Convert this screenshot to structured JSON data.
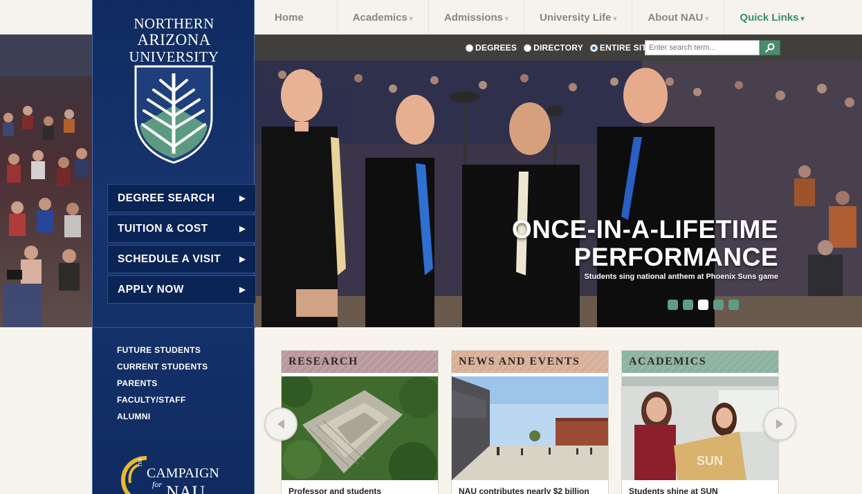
{
  "nav": {
    "items": [
      {
        "label": "Home",
        "caret": ""
      },
      {
        "label": "Academics",
        "caret": "▾"
      },
      {
        "label": "Admissions",
        "caret": "▾"
      },
      {
        "label": "University Life",
        "caret": "▾"
      },
      {
        "label": "About NAU",
        "caret": "▾"
      },
      {
        "label": "Quick Links",
        "caret": "▾"
      }
    ]
  },
  "search": {
    "options": [
      "DEGREES",
      "DIRECTORY",
      "ENTIRE SITE"
    ],
    "selected": "ENTIRE SITE",
    "placeholder": "Enter search term..."
  },
  "logo": {
    "line1": "NORTHERN",
    "line2": "ARIZONA",
    "line3": "UNIVERSITY"
  },
  "ctas": [
    {
      "label": "DEGREE SEARCH",
      "arrow": "▶"
    },
    {
      "label": "TUITION & COST",
      "arrow": "▶"
    },
    {
      "label": "SCHEDULE A VISIT",
      "arrow": "▶"
    },
    {
      "label": "APPLY NOW",
      "arrow": "▶"
    }
  ],
  "audiences": [
    "FUTURE STUDENTS",
    "CURRENT STUDENTS",
    "PARENTS",
    "FACULTY/STAFF",
    "ALUMNI"
  ],
  "campaign": {
    "the": "THE",
    "word": "CAMPAIGN",
    "for": "for",
    "nau": "NAU"
  },
  "hero": {
    "headline_line1": "ONCE-IN-A-LIFETIME",
    "headline_line2": "PERFORMANCE",
    "subtitle": "Students sing national anthem at Phoenix Suns game",
    "slide_count": 5,
    "active_slide": 3
  },
  "cards": [
    {
      "heading": "RESEARCH",
      "caption": "Professor and students"
    },
    {
      "heading": "NEWS AND EVENTS",
      "caption": "NAU contributes nearly $2 billion"
    },
    {
      "heading": "ACADEMICS",
      "caption": "Students shine at SUN"
    }
  ],
  "colors": {
    "navy": "#0f2b61",
    "green": "#3c8a6b",
    "research": "#b8979b",
    "news": "#d7ae98",
    "academics": "#8bb19f"
  }
}
